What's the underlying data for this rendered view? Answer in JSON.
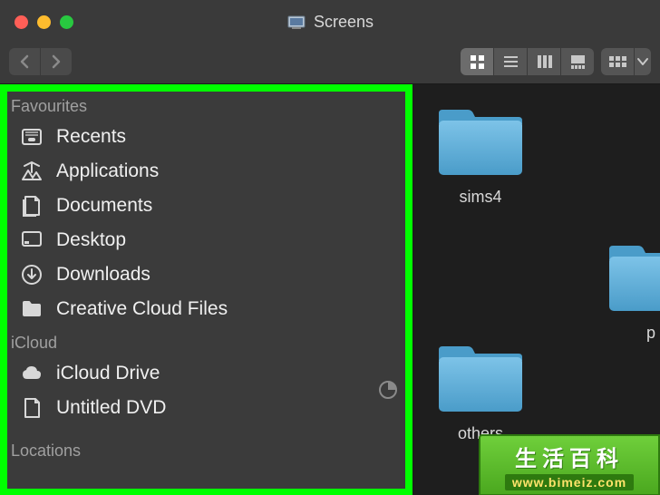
{
  "window": {
    "title": "Screens"
  },
  "sidebar": {
    "sections": {
      "favourites": {
        "header": "Favourites",
        "items": [
          {
            "label": "Recents"
          },
          {
            "label": "Applications"
          },
          {
            "label": "Documents"
          },
          {
            "label": "Desktop"
          },
          {
            "label": "Downloads"
          },
          {
            "label": "Creative Cloud Files"
          }
        ]
      },
      "icloud": {
        "header": "iCloud",
        "items": [
          {
            "label": "iCloud Drive"
          },
          {
            "label": "Untitled DVD"
          }
        ]
      },
      "locations": {
        "header": "Locations"
      }
    }
  },
  "content": {
    "folders": [
      {
        "label": "sims4"
      },
      {
        "label": "others"
      },
      {
        "label": "p"
      }
    ]
  },
  "watermark": {
    "line1": "生活百科",
    "line2": "www.bimeiz.com"
  }
}
